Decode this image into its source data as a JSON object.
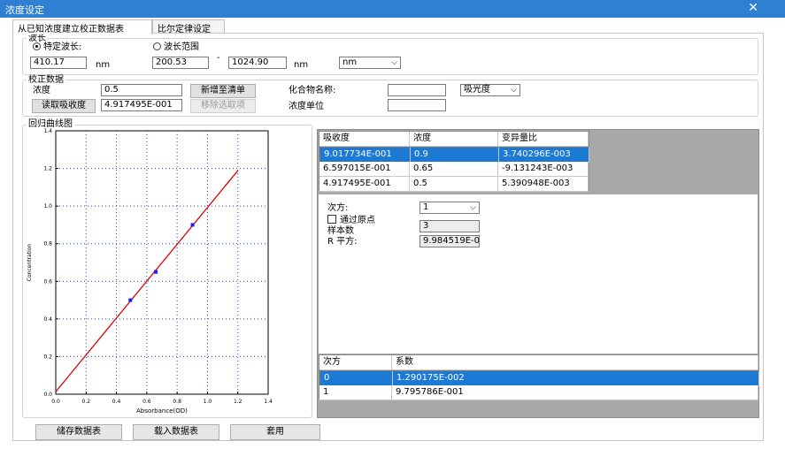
{
  "window": {
    "title": "浓度设定"
  },
  "tabs": [
    {
      "label": "从已知浓度建立校正数据表"
    },
    {
      "label": "比尔定律设定"
    }
  ],
  "wavelength": {
    "group_label": "波长",
    "radio_specific": "特定波长:",
    "radio_range": "波长范围",
    "specific_value": "410.17",
    "unit_nm_1": "nm",
    "range_start": "200.53",
    "range_dash": "-",
    "range_end": "1024.90",
    "unit_nm_2": "nm",
    "unit_select": "nm"
  },
  "calibration": {
    "group_label": "校正数据",
    "conc_label": "浓度",
    "conc_value": "0.5",
    "add_button": "新增至清单",
    "read_abs_button": "读取吸收度",
    "abs_value": "4.917495E-001",
    "remove_button": "移除选取项",
    "compound_label": "化合物名称:",
    "compound_value": "",
    "mode_select": "吸光度",
    "conc_unit_label": "浓度单位",
    "conc_unit_value": ""
  },
  "chart_section": {
    "label": "回归曲线图"
  },
  "chart_data": {
    "type": "scatter",
    "title": "",
    "xlabel": "Absorbance(OD)",
    "ylabel": "Concentration",
    "xlim": [
      0.0,
      1.4
    ],
    "ylim": [
      0.0,
      1.4
    ],
    "x_ticks": [
      "0.0",
      "0.2",
      "0.4",
      "0.6",
      "0.8",
      "1.0",
      "1.2",
      "1.4"
    ],
    "y_ticks": [
      "0.0",
      "0.2",
      "0.4",
      "0.6",
      "0.8",
      "1.0",
      "1.2",
      "1.4"
    ],
    "grid": true,
    "series": [
      {
        "points": [
          [
            0.4917495,
            0.5
          ],
          [
            0.6597015,
            0.65
          ],
          [
            0.9017734,
            0.9
          ]
        ]
      }
    ],
    "fit_line": {
      "intercept": 0.01290175,
      "slope": 0.9795786,
      "x_range": [
        0.0,
        1.2
      ]
    },
    "colors": {
      "line": "#e00000",
      "points": "#1a1aff"
    }
  },
  "data_table": {
    "headers": [
      "吸收度",
      "浓度",
      "变异量比"
    ],
    "rows": [
      [
        "9.017734E-001",
        "0.9",
        "3.740296E-003"
      ],
      [
        "6.597015E-001",
        "0.65",
        "-9.131243E-003"
      ],
      [
        "4.917495E-001",
        "0.5",
        "5.390948E-003"
      ]
    ]
  },
  "regression": {
    "order_label": "次方:",
    "order_value": "1",
    "origin_label": "通过原点",
    "samples_label": "样本数",
    "samples_value": "3",
    "r2_label": "R 平方:",
    "r2_value": "9.984519E-0"
  },
  "coef_table": {
    "headers": [
      "次方",
      "系数"
    ],
    "rows": [
      [
        "0",
        "1.290175E-002"
      ],
      [
        "1",
        "9.795786E-001"
      ]
    ]
  },
  "bottom_buttons": {
    "save": "储存数据表",
    "load": "载入数据表",
    "apply": "套用"
  },
  "colors": {
    "titlebar": "#2f7fd2",
    "selection": "#1c7ad5",
    "fit_line": "#e00000"
  }
}
